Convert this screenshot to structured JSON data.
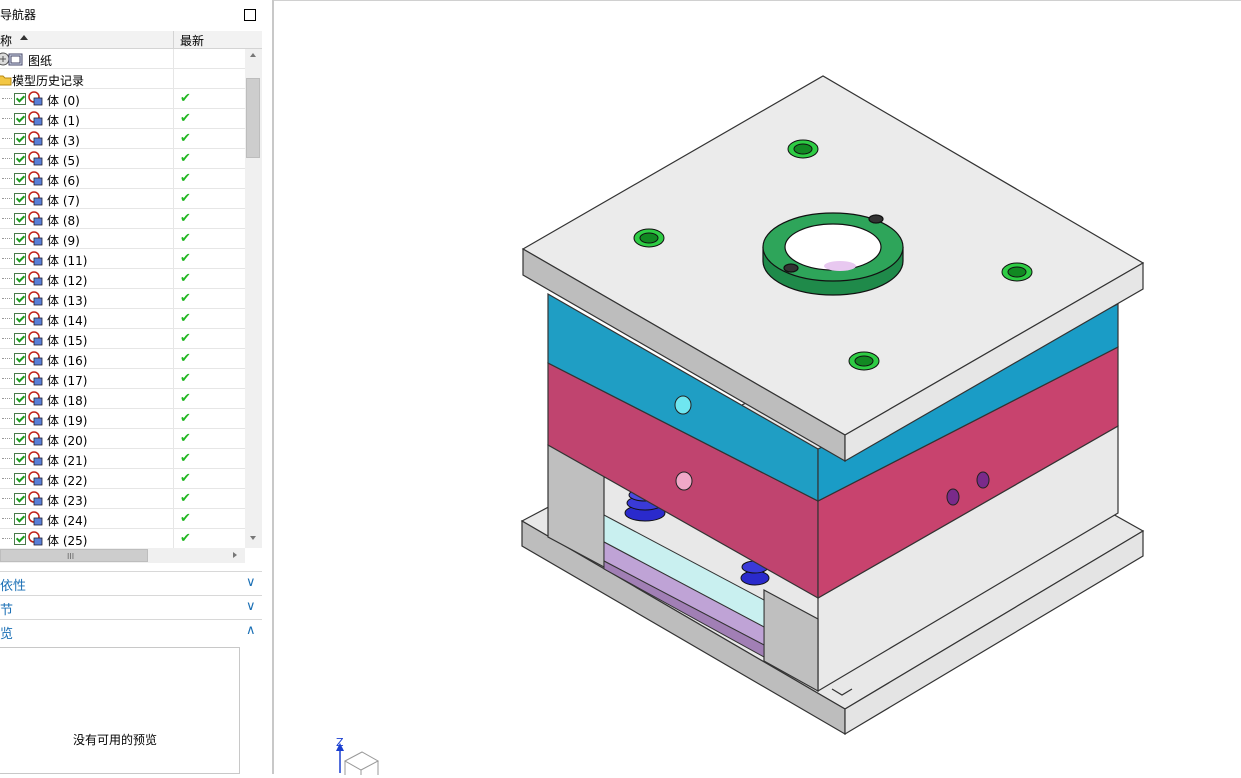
{
  "navigator": {
    "title": "导航器",
    "col_name": "称",
    "col_latest": "最新",
    "items": [
      {
        "label": "图纸",
        "kind": "drawing"
      },
      {
        "label": "模型历史记录",
        "kind": "folder"
      }
    ],
    "bodies": [
      {
        "label": "体 (0)",
        "latest": "✔"
      },
      {
        "label": "体 (1)",
        "latest": "✔"
      },
      {
        "label": "体 (3)",
        "latest": "✔"
      },
      {
        "label": "体 (5)",
        "latest": "✔"
      },
      {
        "label": "体 (6)",
        "latest": "✔"
      },
      {
        "label": "体 (7)",
        "latest": "✔"
      },
      {
        "label": "体 (8)",
        "latest": "✔"
      },
      {
        "label": "体 (9)",
        "latest": "✔"
      },
      {
        "label": "体 (11)",
        "latest": "✔"
      },
      {
        "label": "体 (12)",
        "latest": "✔"
      },
      {
        "label": "体 (13)",
        "latest": "✔"
      },
      {
        "label": "体 (14)",
        "latest": "✔"
      },
      {
        "label": "体 (15)",
        "latest": "✔"
      },
      {
        "label": "体 (16)",
        "latest": "✔"
      },
      {
        "label": "体 (17)",
        "latest": "✔"
      },
      {
        "label": "体 (18)",
        "latest": "✔"
      },
      {
        "label": "体 (19)",
        "latest": "✔"
      },
      {
        "label": "体 (20)",
        "latest": "✔"
      },
      {
        "label": "体 (21)",
        "latest": "✔"
      },
      {
        "label": "体 (22)",
        "latest": "✔"
      },
      {
        "label": "体 (23)",
        "latest": "✔"
      },
      {
        "label": "体 (24)",
        "latest": "✔"
      },
      {
        "label": "体 (25)",
        "latest": "✔"
      }
    ],
    "hscroll_grip": "III"
  },
  "panels": {
    "dependencies": "依性",
    "details": "节",
    "preview": "览",
    "preview_empty": "没有可用的预览",
    "collapsed_chevron": "∨",
    "expanded_chevron": "∧"
  },
  "triad": {
    "z_label": "Z"
  },
  "colors": {
    "plate_gray": "#d9d9d9",
    "plate_blue": "#1f9ec4",
    "plate_magenta": "#c8436e",
    "ring_green": "#2ea55a",
    "check_green": "#22b722",
    "panel_blue": "#1a6fb5"
  }
}
